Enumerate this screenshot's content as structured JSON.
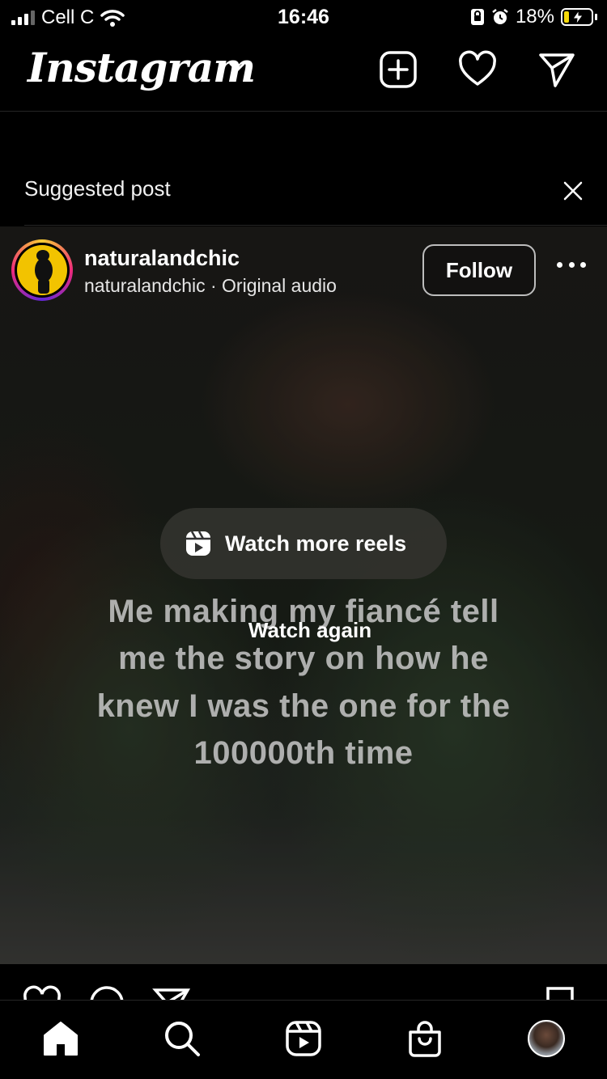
{
  "status_bar": {
    "carrier": "Cell C",
    "time": "16:46",
    "battery": "18%",
    "battery_level": 0.18,
    "icons": [
      "signal-icon",
      "wifi-icon",
      "orientation-lock-icon",
      "alarm-icon",
      "battery-charging-icon"
    ]
  },
  "header": {
    "logo": "Instagram",
    "icons": [
      "chevron-down-icon",
      "create-post-icon",
      "heart-icon",
      "send-icon"
    ]
  },
  "suggested": {
    "label": "Suggested post",
    "close_icon": "close-icon"
  },
  "post": {
    "username": "naturalandchic",
    "subline": "naturalandchic · Original audio",
    "follow_label": "Follow",
    "more_icon": "more-icon",
    "watch_more_label": "Watch more reels",
    "caption_lines": [
      "Me making my fiancé tell",
      "me the story on how he",
      "knew I was the one for the",
      "100000th time"
    ],
    "watch_again_label": "Watch again",
    "actions": [
      "like-icon",
      "comment-icon",
      "share-icon",
      "save-icon"
    ]
  },
  "bottom_nav": {
    "items": [
      "home-icon",
      "search-icon",
      "reels-icon",
      "shop-icon",
      "profile-avatar"
    ]
  },
  "colors": {
    "background": "#000000",
    "battery_fill": "#f5d90a",
    "avatar_bg": "#f2c300"
  }
}
